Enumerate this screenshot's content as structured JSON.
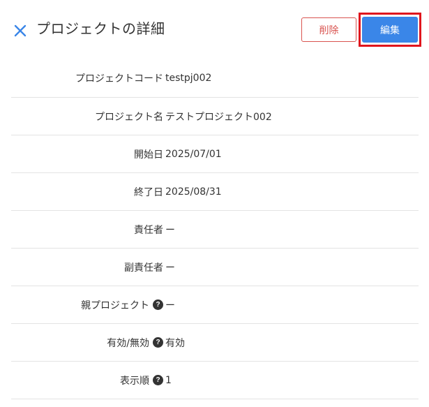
{
  "header": {
    "title": "プロジェクトの詳細",
    "delete_label": "削除",
    "edit_label": "編集"
  },
  "colors": {
    "accent": "#3a86e8",
    "danger": "#d9534f",
    "highlight": "#e0151d"
  },
  "fields": [
    {
      "label": "プロジェクトコード",
      "value": "testpj002"
    },
    {
      "label": "プロジェクト名",
      "value": "テストプロジェクト002"
    },
    {
      "label": "開始日",
      "value": "2025/07/01"
    },
    {
      "label": "終了日",
      "value": "2025/08/31"
    },
    {
      "label": "責任者",
      "value": "ー"
    },
    {
      "label": "副責任者",
      "value": "ー"
    },
    {
      "label": "親プロジェクト",
      "value": "ー",
      "help": true
    },
    {
      "label": "有効/無効",
      "value": "有効",
      "help": true
    },
    {
      "label": "表示順",
      "value": "1",
      "help": true
    }
  ],
  "help_glyph": "?"
}
